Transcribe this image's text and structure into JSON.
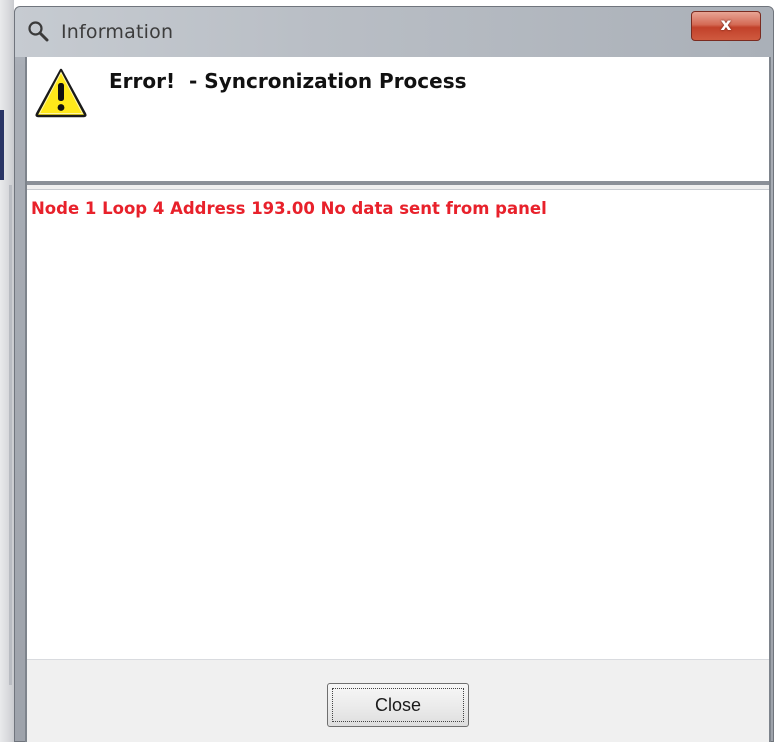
{
  "window": {
    "title": "Information",
    "close_glyph": "x",
    "title_icon": "magnifier-icon"
  },
  "header": {
    "icon": "warning-icon",
    "title": "Error!  - Syncronization Process"
  },
  "message": {
    "text": "Node 1 Loop 4 Address 193.00 No data sent from panel",
    "color": "#e8212b"
  },
  "footer": {
    "close_label": "Close"
  },
  "colors": {
    "warning_yellow": "#ffe81a",
    "titlebar_close_red": "#c2412a"
  }
}
